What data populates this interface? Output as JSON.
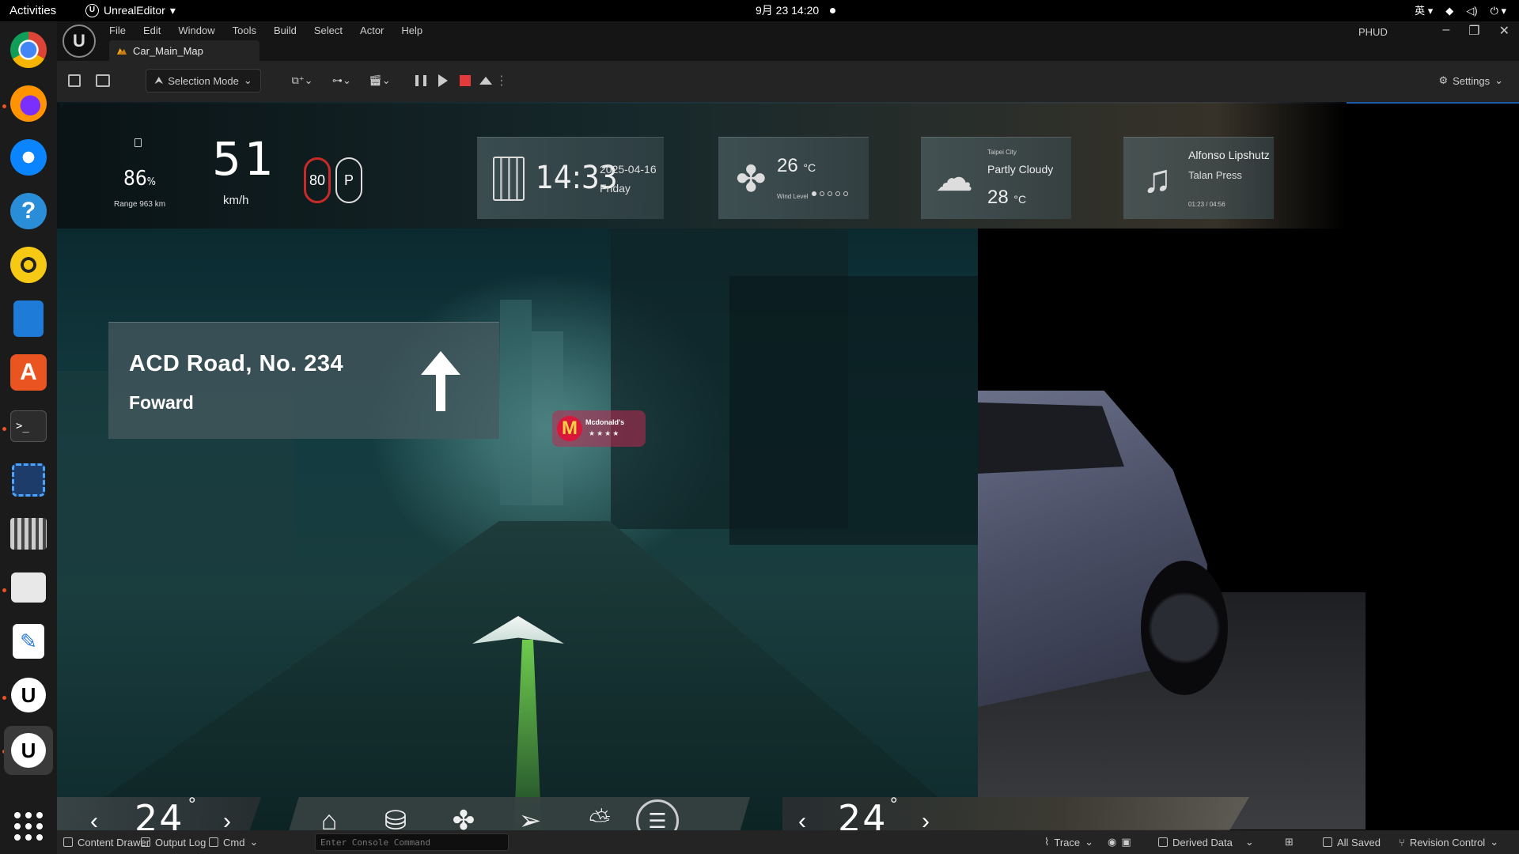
{
  "topbar": {
    "activities": "Activities",
    "app_name": "UnrealEditor",
    "clock": "9月 23  14:20",
    "input_method": "英"
  },
  "dock": {
    "items": [
      "chrome-icon",
      "firefox-icon",
      "thunderbird-icon",
      "help-icon",
      "rhythmbox-icon",
      "writer-icon",
      "app-center-icon",
      "terminal-icon",
      "screenshot-icon",
      "video-icon",
      "files-icon",
      "text-editor-icon",
      "unreal-icon",
      "unreal-active-icon",
      "app-grid-icon"
    ]
  },
  "editor": {
    "logo": "U",
    "menus": [
      "File",
      "Edit",
      "Window",
      "Tools",
      "Build",
      "Select",
      "Actor",
      "Help"
    ],
    "map_tab": "Car_Main_Map",
    "window_label": "PHUD",
    "toolbar": {
      "selection_mode": "Selection Mode",
      "settings": "Settings"
    }
  },
  "hud": {
    "battery_pct": "86",
    "battery_unit": "%",
    "range": "Range 963 km",
    "speed": "51",
    "speed_unit": "km/h",
    "speed_limit": "80",
    "gear": "P",
    "time": "14:33",
    "date": "2025-04-16",
    "day": "Friday",
    "fan_temp": "26",
    "fan_temp_unit": "°C",
    "wind_label": "Wind Level",
    "wind_level": 1,
    "city": "Taipei City",
    "weather_cond": "Partly Cloudy",
    "weather_temp": "28",
    "weather_temp_unit": "°C",
    "artist": "Alfonso Lipshutz",
    "track": "Talan Press",
    "progress": "01:23 / 04:56"
  },
  "nav": {
    "street": "ACD Road, No. 234",
    "direction": "Foward"
  },
  "poi": {
    "logo": "M",
    "name": "Mcdonald's",
    "stars": "★★★★"
  },
  "climate": {
    "left_temp": "24",
    "right_temp": "24",
    "degree": "°",
    "prev": "‹",
    "next": "›"
  },
  "statusbar": {
    "content_drawer": "Content Drawer",
    "output_log": "Output Log",
    "cmd": "Cmd",
    "console_placeholder": "Enter Console Command",
    "trace": "Trace",
    "derived_data": "Derived Data",
    "all_saved": "All Saved",
    "revision_control": "Revision Control"
  }
}
